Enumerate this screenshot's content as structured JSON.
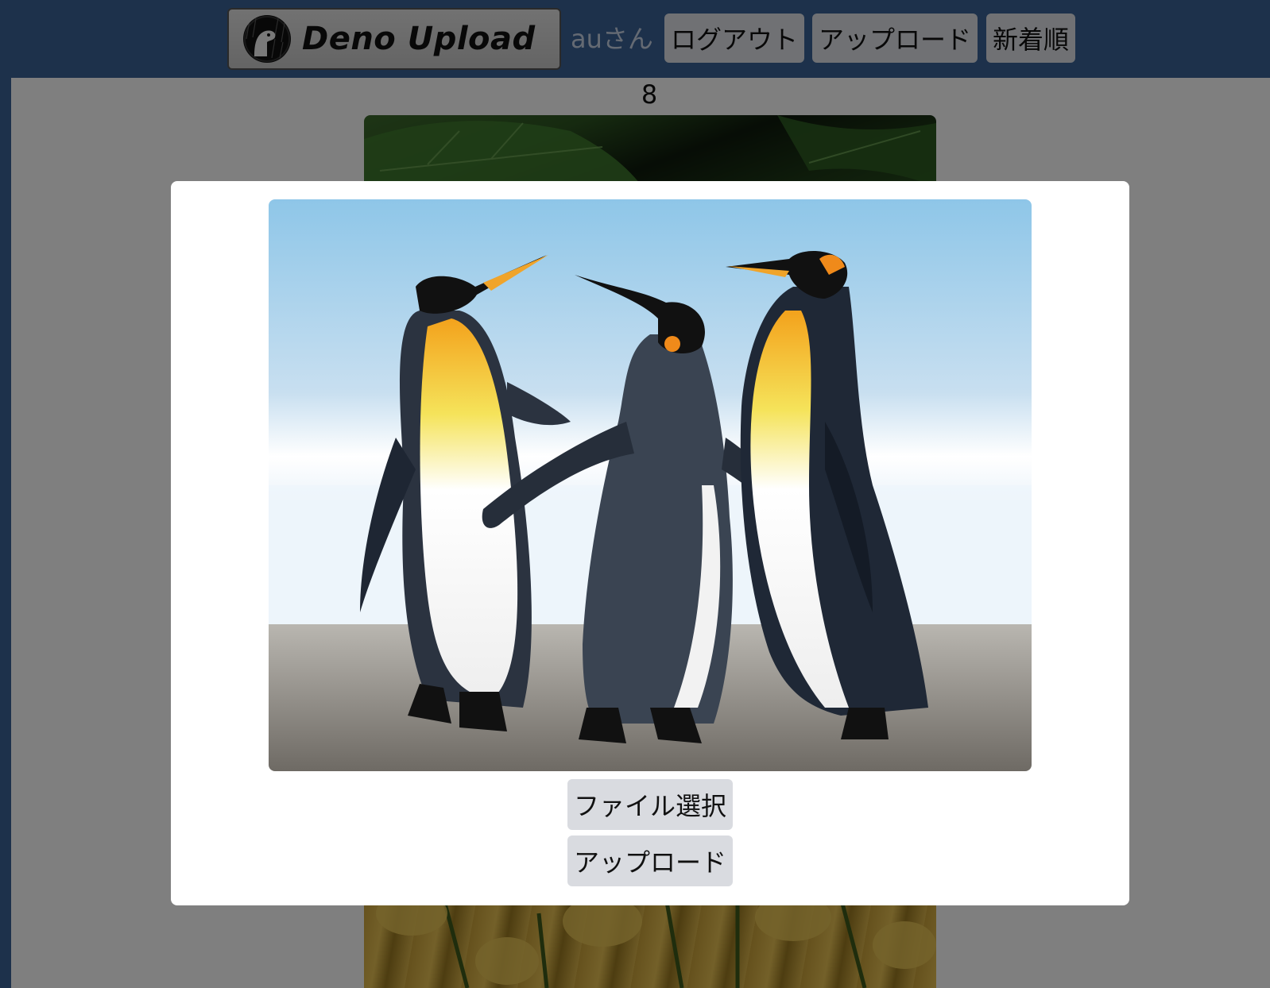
{
  "header": {
    "logo_text": "Deno Upload",
    "user_label": "auさん",
    "logout_label": "ログアウト",
    "upload_label": "アップロード",
    "sort_label": "新着順"
  },
  "main": {
    "count": "8"
  },
  "modal": {
    "select_file_label": "ファイル選択",
    "upload_label": "アップロード"
  },
  "colors": {
    "header_bg": "#3b6296",
    "button_bg": "#e1e3e8",
    "overlay": "rgba(0,0,0,0.5)"
  }
}
